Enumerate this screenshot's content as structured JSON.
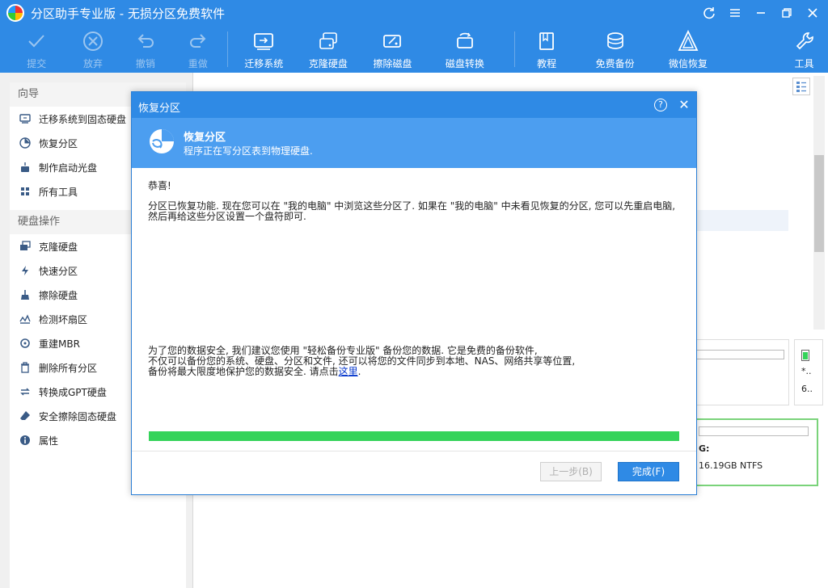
{
  "app": {
    "title": "分区助手专业版 - 无损分区免费软件"
  },
  "colors": {
    "accent": "#2f8ae5",
    "progress": "#35d35a"
  },
  "toolbar": {
    "items": [
      {
        "label": "提交",
        "icon": "check-icon",
        "enabled": false
      },
      {
        "label": "放弃",
        "icon": "cancel-circle-icon",
        "enabled": false
      },
      {
        "label": "撤销",
        "icon": "undo-icon",
        "enabled": false
      },
      {
        "label": "重做",
        "icon": "redo-icon",
        "enabled": false
      },
      {
        "label": "迁移系统",
        "icon": "migrate-os-icon",
        "enabled": true
      },
      {
        "label": "克隆硬盘",
        "icon": "clone-disk-icon",
        "enabled": true
      },
      {
        "label": "擦除磁盘",
        "icon": "wipe-disk-icon",
        "enabled": true
      },
      {
        "label": "磁盘转换",
        "icon": "disk-convert-icon",
        "enabled": true
      },
      {
        "label": "教程",
        "icon": "book-icon",
        "enabled": true
      },
      {
        "label": "免费备份",
        "icon": "backup-icon",
        "enabled": true
      },
      {
        "label": "微信恢复",
        "icon": "wechat-recovery-icon",
        "enabled": true
      },
      {
        "label": "工具",
        "icon": "wrench-icon",
        "enabled": true
      }
    ]
  },
  "sidebar": {
    "wizard_title": "向导",
    "wizard_items": [
      {
        "label": "迁移系统到固态硬盘",
        "icon": "migrate-icon"
      },
      {
        "label": "恢复分区",
        "icon": "recover-icon"
      },
      {
        "label": "制作启动光盘",
        "icon": "boot-disc-icon"
      },
      {
        "label": "所有工具",
        "icon": "grid-icon"
      }
    ],
    "disk_ops_title": "硬盘操作",
    "disk_ops_items": [
      {
        "label": "克隆硬盘",
        "icon": "clone-icon"
      },
      {
        "label": "快速分区",
        "icon": "lightning-icon"
      },
      {
        "label": "擦除硬盘",
        "icon": "broom-icon"
      },
      {
        "label": "检测坏扇区",
        "icon": "scan-icon"
      },
      {
        "label": "重建MBR",
        "icon": "rebuild-icon"
      },
      {
        "label": "删除所有分区",
        "icon": "trash-icon"
      },
      {
        "label": "转换成GPT硬盘",
        "icon": "convert-icon"
      },
      {
        "label": "安全擦除固态硬盘",
        "icon": "eraser-icon"
      },
      {
        "label": "属性",
        "icon": "info-icon"
      }
    ]
  },
  "background": {
    "disk2_label": "G:",
    "disk2_size": "16.19GB NTFS",
    "side_text_1": "*..",
    "side_text_2": "6.."
  },
  "dialog": {
    "title": "恢复分区",
    "header_title": "恢复分区",
    "header_subtitle": "程序正在写分区表到物理硬盘.",
    "congrats": "恭喜!",
    "message": "分区已恢复功能. 现在您可以在 \"我的电脑\" 中浏览这些分区了. 如果在 \"我的电脑\" 中未看见恢复的分区, 您可以先重启电脑, 然后再给这些分区设置一个盘符即可.",
    "note_line1": "为了您的数据安全, 我们建议您使用 \"轻松备份专业版\" 备份您的数据. 它是免费的备份软件,",
    "note_line2": "不仅可以备份您的系统、硬盘、分区和文件, 还可以将您的文件同步到本地、NAS、网络共享等位置,",
    "note_line3": "备份将最大限度地保护您的数据安全. 请点击",
    "note_link": "这里",
    "note_end": ".",
    "progress": 1.0,
    "prev_button": "上一步(B)",
    "finish_button": "完成(F)"
  }
}
